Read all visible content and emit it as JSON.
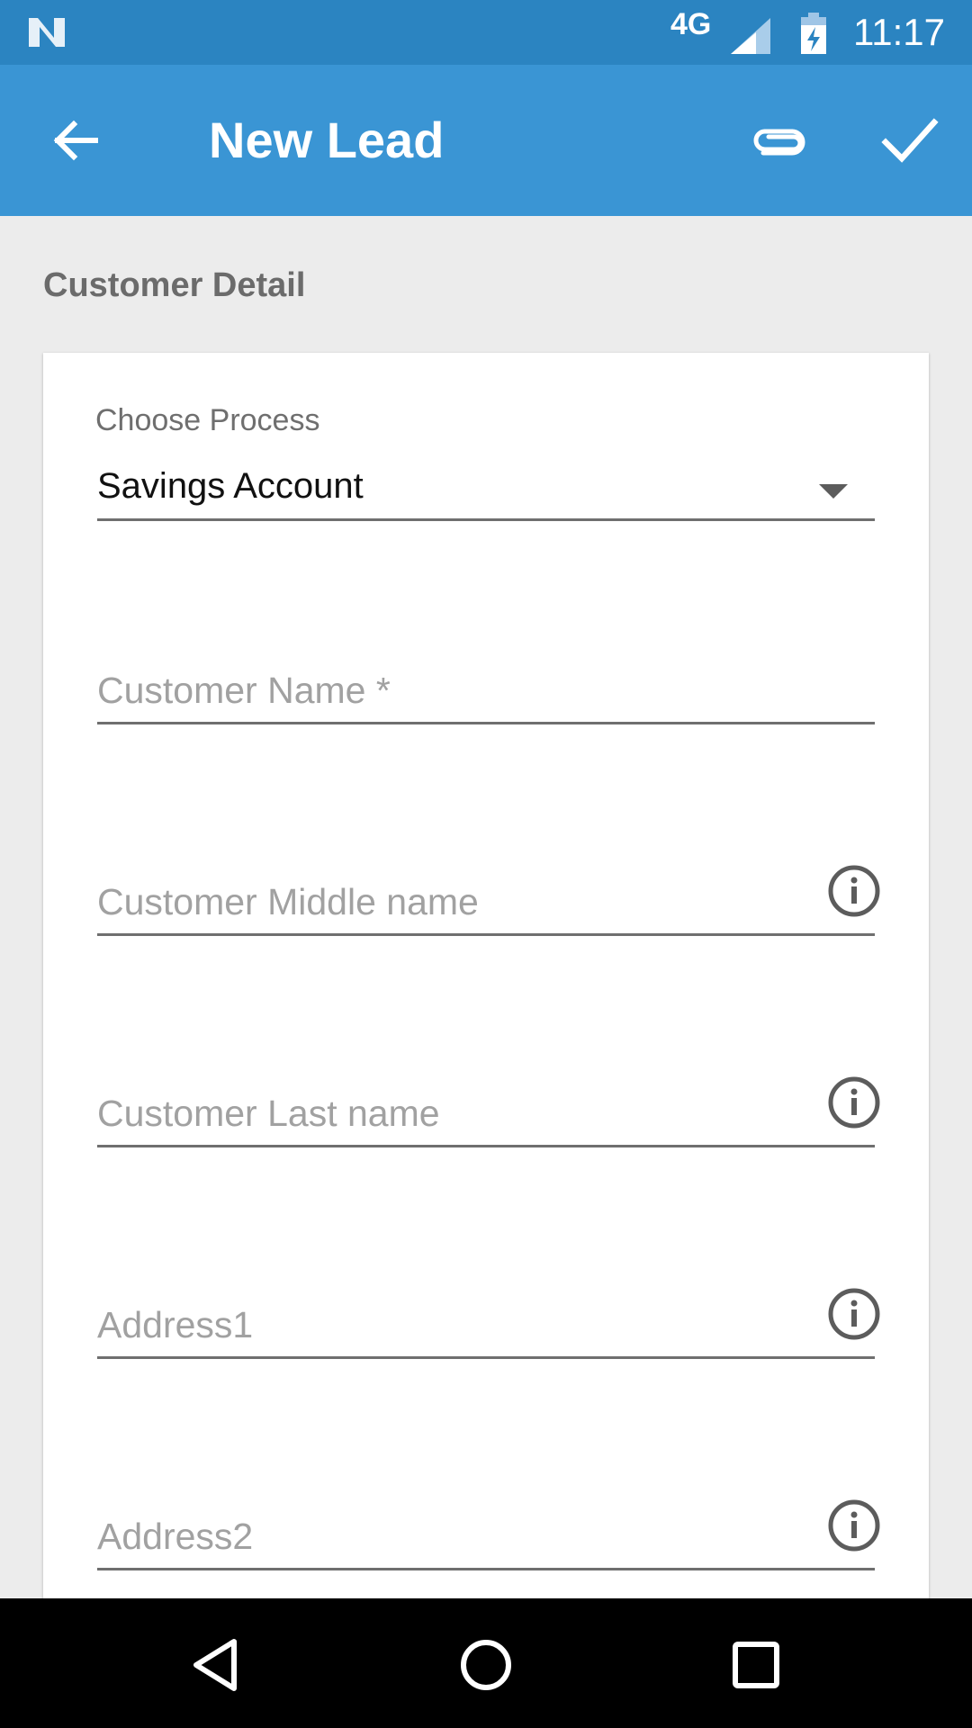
{
  "status_bar": {
    "network": "4G",
    "time": "11:17",
    "icons": [
      "notification-n-icon",
      "signal-icon",
      "battery-charging-icon"
    ]
  },
  "app_bar": {
    "title": "New Lead",
    "icons": [
      "arrow-back-icon",
      "attach-icon",
      "check-icon"
    ]
  },
  "section": {
    "title": "Customer Detail"
  },
  "form": {
    "process_label": "Choose Process",
    "process_value": "Savings Account",
    "fields": [
      {
        "placeholder": "Customer Name *"
      },
      {
        "placeholder": "Customer Middle name"
      },
      {
        "placeholder": "Customer Last name"
      },
      {
        "placeholder": "Address1"
      },
      {
        "placeholder": "Address2"
      }
    ]
  },
  "nav_bar": {
    "icons": [
      "nav-back-icon",
      "nav-home-icon",
      "nav-recents-icon"
    ]
  },
  "colors": {
    "status_bar": "#2b84c1",
    "app_bar": "#3a95d4",
    "background": "#ececec"
  }
}
